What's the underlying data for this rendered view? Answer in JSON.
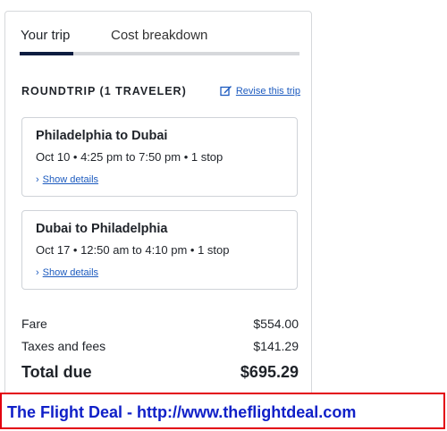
{
  "tabs": [
    {
      "label": "Your trip",
      "active": true
    },
    {
      "label": "Cost breakdown",
      "active": false
    }
  ],
  "trip": {
    "title": "ROUNDTRIP (1 TRAVELER)",
    "revise_label": "Revise this trip",
    "revise_icon": "edit-icon"
  },
  "flights": [
    {
      "route": "Philadelphia to Dubai",
      "schedule": "Oct 10 • 4:25 pm to 7:50 pm • 1 stop",
      "details_label": "Show details"
    },
    {
      "route": "Dubai to Philadelphia",
      "schedule": "Oct 17 • 12:50 am to 4:10 pm • 1 stop",
      "details_label": "Show details"
    }
  ],
  "costs": {
    "fare_label": "Fare",
    "fare_value": "$554.00",
    "taxes_label": "Taxes and fees",
    "taxes_value": "$141.29",
    "total_label": "Total due",
    "total_value": "$695.29"
  },
  "banner": {
    "text": "The Flight Deal - http://www.theflightdeal.com"
  },
  "colors": {
    "link": "#1d5bbf",
    "active_tab": "#0d1d40",
    "banner_border": "#e3000f",
    "banner_text": "#1020c8"
  }
}
